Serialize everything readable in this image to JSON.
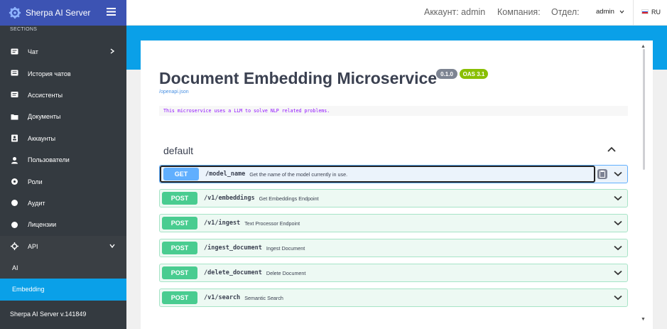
{
  "app": {
    "title": "Sherpa AI Server",
    "version": "Sherpa AI Server v.141849",
    "brand_color": "#3c53b3"
  },
  "sidebar": {
    "section_label": "SECTIONS",
    "items": [
      {
        "label": "Чат",
        "icon": "chat-icon"
      },
      {
        "label": "История чатов",
        "icon": "chat-history-icon"
      },
      {
        "label": "Ассистенты",
        "icon": "assistant-icon"
      },
      {
        "label": "Документы",
        "icon": "folder-icon"
      },
      {
        "label": "Аккаунты",
        "icon": "account-icon"
      },
      {
        "label": "Пользователи",
        "icon": "user-icon"
      },
      {
        "label": "Роли",
        "icon": "role-icon"
      },
      {
        "label": "Аудит",
        "icon": "audit-icon"
      },
      {
        "label": "Лицензии",
        "icon": "license-icon"
      },
      {
        "label": "API",
        "icon": "api-icon"
      }
    ],
    "api_children": [
      {
        "label": "AI",
        "active": false
      },
      {
        "label": "Embedding",
        "active": true
      }
    ],
    "active_color": "#0aa0e8"
  },
  "topbar": {
    "account": "Аккаунт: admin",
    "company": "Компания:",
    "department": "Отдел:",
    "user": "admin",
    "lang": "RU"
  },
  "api_doc": {
    "title": "Document Embedding Microservice",
    "version_badge": "0.1.0",
    "oas_badge": "OAS 3.1",
    "spec_link": "/openapi.json",
    "description": "This microservice uses a LLM to solve NLP related problems.",
    "section": "default",
    "operations": [
      {
        "method": "GET",
        "path": "/model_name",
        "summary": "Get the name of the model currently in use."
      },
      {
        "method": "POST",
        "path": "/v1/embeddings",
        "summary": "Get Embeddings Endpoint"
      },
      {
        "method": "POST",
        "path": "/v1/ingest",
        "summary": "Text Processor Endpoint"
      },
      {
        "method": "POST",
        "path": "/ingest_document",
        "summary": "Ingest Document"
      },
      {
        "method": "POST",
        "path": "/delete_document",
        "summary": "Delete Document"
      },
      {
        "method": "POST",
        "path": "/v1/search",
        "summary": "Semantic Search"
      }
    ]
  }
}
